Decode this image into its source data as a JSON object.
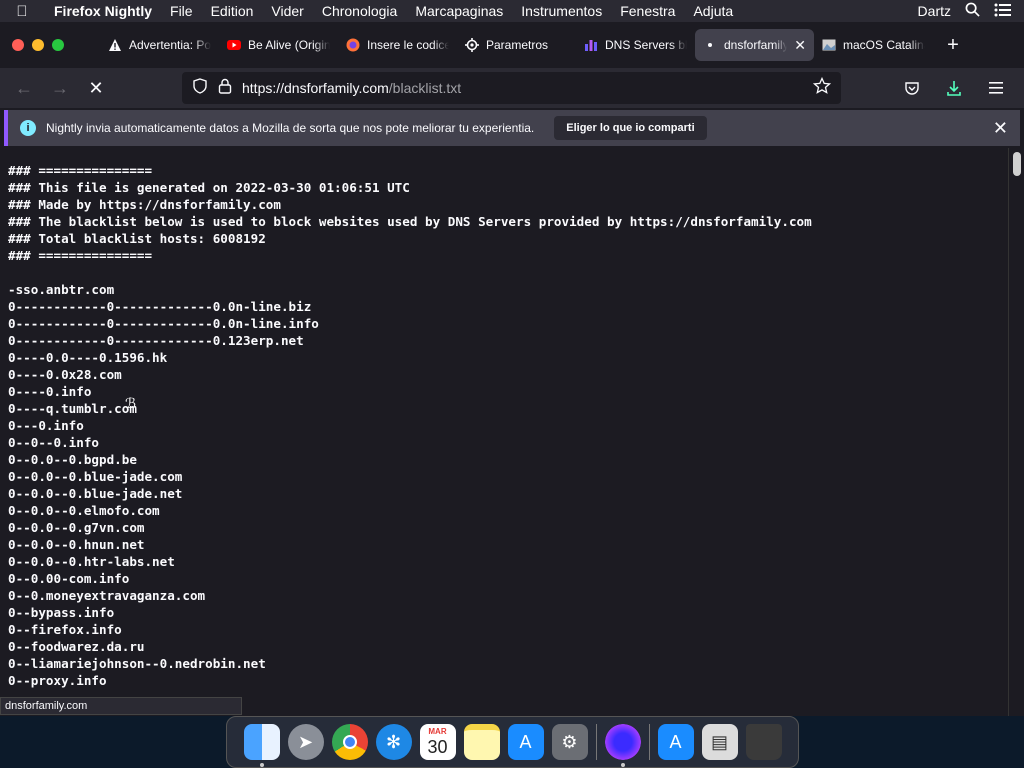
{
  "menubar": {
    "app_name": "Firefox Nightly",
    "items": [
      "File",
      "Edition",
      "Vider",
      "Chronologia",
      "Marcapaginas",
      "Instrumentos",
      "Fenestra",
      "Adjuta"
    ],
    "user": "Dartz"
  },
  "tabs": [
    {
      "label": "Advertentia: Potential Security Risk Ahead",
      "icon": "warning-icon"
    },
    {
      "label": "Be Alive (Original)",
      "icon": "youtube-icon"
    },
    {
      "label": "Insere le codice",
      "icon": "firefox-icon"
    },
    {
      "label": "Parametros",
      "icon": "gear-icon"
    },
    {
      "label": "DNS Servers blocking",
      "icon": "chart-icon"
    },
    {
      "label": "dnsforfamily.com",
      "icon": "loading-dot-icon",
      "active": true
    },
    {
      "label": "macOS Catalina",
      "icon": "image-icon"
    }
  ],
  "urlbar": {
    "host": "https://dnsforfamily.com",
    "path": "/blacklist.txt"
  },
  "notification": {
    "text": "Nightly invia automaticamente datos a Mozilla de sorta que nos pote meliorar tu experientia.",
    "button": "Eliger lo que io comparti"
  },
  "file_lines": [
    "### ===============",
    "### This file is generated on 2022-03-30 01:06:51 UTC",
    "### Made by https://dnsforfamily.com",
    "### The blacklist below is used to block websites used by DNS Servers provided by https://dnsforfamily.com",
    "### Total blacklist hosts: 6008192",
    "### ===============",
    "",
    "-sso.anbtr.com",
    "0------------0-------------0.0n-line.biz",
    "0------------0-------------0.0n-line.info",
    "0------------0-------------0.123erp.net",
    "0----0.0----0.1596.hk",
    "0----0.0x28.com",
    "0----0.info",
    "0----q.tumblr.com",
    "0---0.info",
    "0--0--0.info",
    "0--0.0--0.bgpd.be",
    "0--0.0--0.blue-jade.com",
    "0--0.0--0.blue-jade.net",
    "0--0.0--0.elmofo.com",
    "0--0.0--0.g7vn.com",
    "0--0.0--0.hnun.net",
    "0--0.0--0.htr-labs.net",
    "0--0.00-com.info",
    "0--0.moneyextravaganza.com",
    "0--bypass.info",
    "0--firefox.info",
    "0--foodwarez.da.ru",
    "0--liamariejohnson--0.nedrobin.net",
    "0--proxy.info"
  ],
  "status_text": "dnsforfamily.com",
  "dock": {
    "calendar_month": "MAR",
    "calendar_day": "30",
    "apps": [
      "finder-icon",
      "launchpad-icon",
      "chrome-icon",
      "safari-icon",
      "calendar-icon",
      "notes-icon",
      "app-store-icon",
      "system-preferences-icon",
      "firefox-nightly-icon",
      "app-store-icon",
      "preview-icon",
      "trash-icon"
    ]
  }
}
